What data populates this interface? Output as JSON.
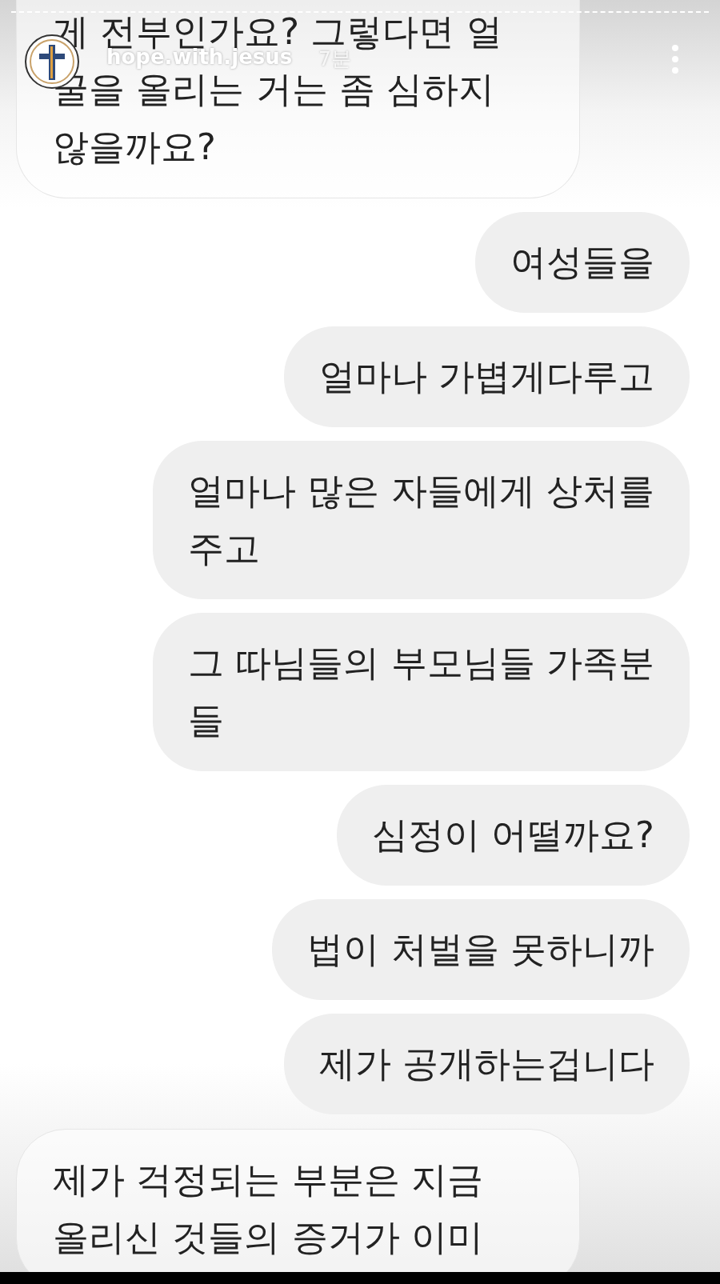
{
  "story_header": {
    "username": "hope.with.jesus",
    "time": "7분"
  },
  "messages": [
    {
      "kind": "received",
      "text": "게 전부인가요? 그렇다면 얼\n굴을 올리는 거는 좀 심하지\n않을까요?"
    },
    {
      "kind": "sent",
      "text": "여성들을"
    },
    {
      "kind": "sent",
      "text": "얼마나 가볍게다루고"
    },
    {
      "kind": "sent",
      "text": "얼마나 많은 자들에게 상처를\n주고"
    },
    {
      "kind": "sent",
      "text": "그 따님들의 부모님들 가족분\n들"
    },
    {
      "kind": "sent",
      "text": "심정이 어떨까요?"
    },
    {
      "kind": "sent",
      "text": "법이 처벌을 못하니까"
    },
    {
      "kind": "sent",
      "text": "제가 공개하는겁니다"
    },
    {
      "kind": "received",
      "text": "제가 걱정되는 부분은 지금\n올리신 것들의 증거가 이미"
    }
  ]
}
